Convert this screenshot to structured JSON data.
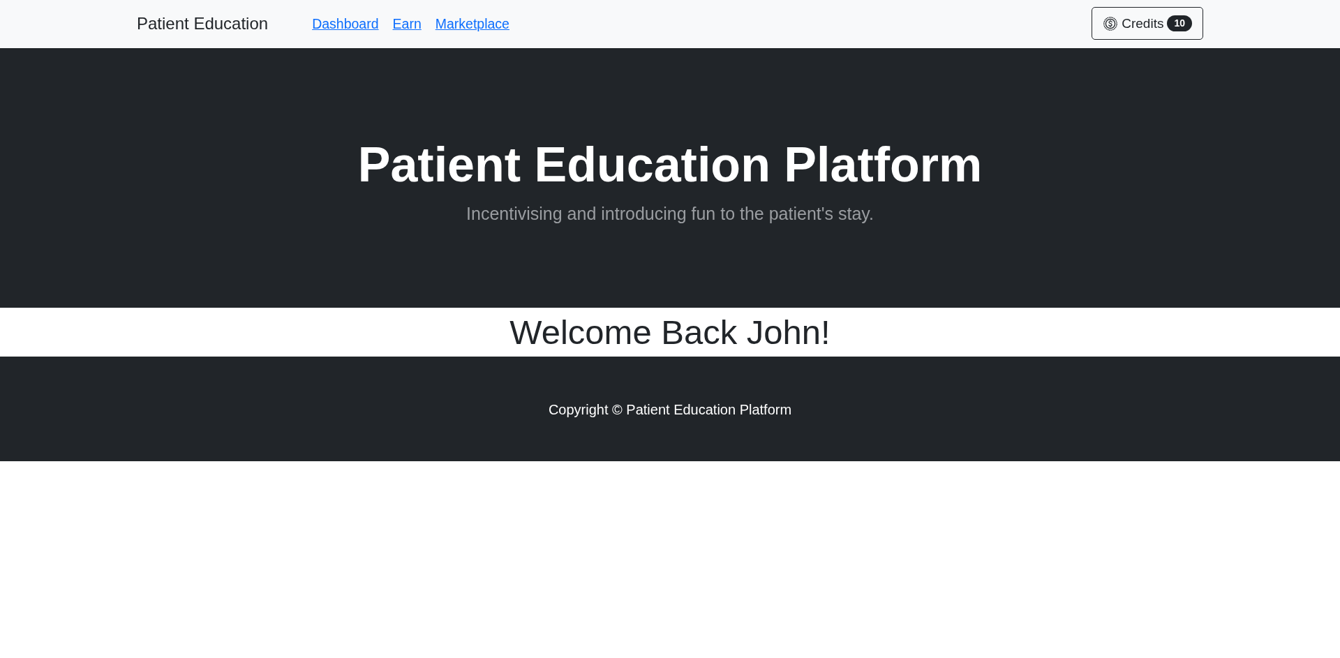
{
  "navbar": {
    "brand": "Patient Education",
    "links": [
      "Dashboard",
      "Earn",
      "Marketplace"
    ],
    "credits_button": {
      "label": "Credits",
      "badge": "10"
    }
  },
  "hero": {
    "title": "Patient Education Platform",
    "subtitle": "Incentivising and introducing fun to the patient's stay."
  },
  "welcome": {
    "heading": "Welcome Back John!"
  },
  "footer": {
    "copyright": "Copyright © Patient Education Platform"
  }
}
